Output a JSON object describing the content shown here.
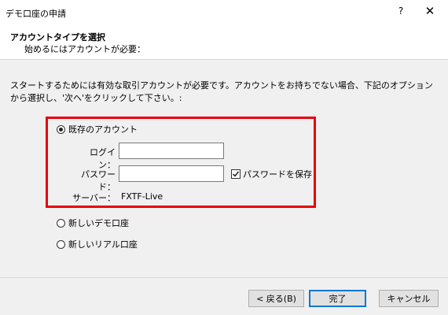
{
  "window": {
    "title": "デモ口座の申請",
    "help_label": "?",
    "close_label": "✕"
  },
  "header": {
    "title": "アカウントタイプを選択",
    "subtitle": "始めるにはアカウントが必要："
  },
  "instruction": "スタートするためには有効な取引アカウントが必要です。アカウントをお持ちでない場合、下記のオプションから選択し、'次へ'をクリックして下さい。:",
  "options": {
    "existing": {
      "label": "既存のアカウント",
      "selected": true
    },
    "new_demo": {
      "label": "新しいデモ口座",
      "selected": false
    },
    "new_real": {
      "label": "新しいリアル口座",
      "selected": false
    }
  },
  "form": {
    "login_label": "ログイン：",
    "login_value": "",
    "password_label": "パスワード：",
    "password_value": "",
    "save_password_label": "パスワードを保存",
    "save_password_checked": true,
    "server_label": "サーバー：",
    "server_value": "FXTF-Live"
  },
  "buttons": {
    "back": "< 戻る(B)",
    "finish": "完了",
    "cancel": "キャンセル"
  },
  "colors": {
    "highlight": "#e8000b",
    "primary_border": "#0078d7"
  }
}
